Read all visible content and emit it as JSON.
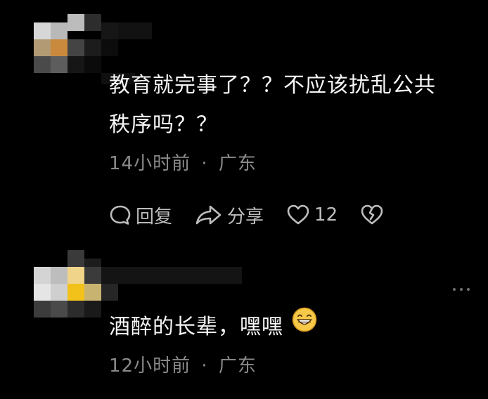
{
  "comments": [
    {
      "text_line1": "教育就完事了？？不应该扰乱公共",
      "text_line2": "秩序吗？？",
      "time": "14小时前",
      "separator": "·",
      "location": "广东",
      "actions": {
        "reply_label": "回复",
        "share_label": "分享",
        "like_count": "12"
      },
      "icons": [
        "reply-icon",
        "share-icon",
        "heart-icon",
        "broken-heart-icon"
      ]
    },
    {
      "text": "酒醉的长辈，嘿嘿",
      "emoji": "grin-emoji",
      "time": "12小时前",
      "separator": "·",
      "location": "广东",
      "icons": [
        "more-icon"
      ]
    }
  ],
  "colors": {
    "background": "#000000",
    "text": "#f5f5f5",
    "meta": "#8a8a8a",
    "action": "#bdbdbd",
    "emoji_face": "#f7c948"
  }
}
